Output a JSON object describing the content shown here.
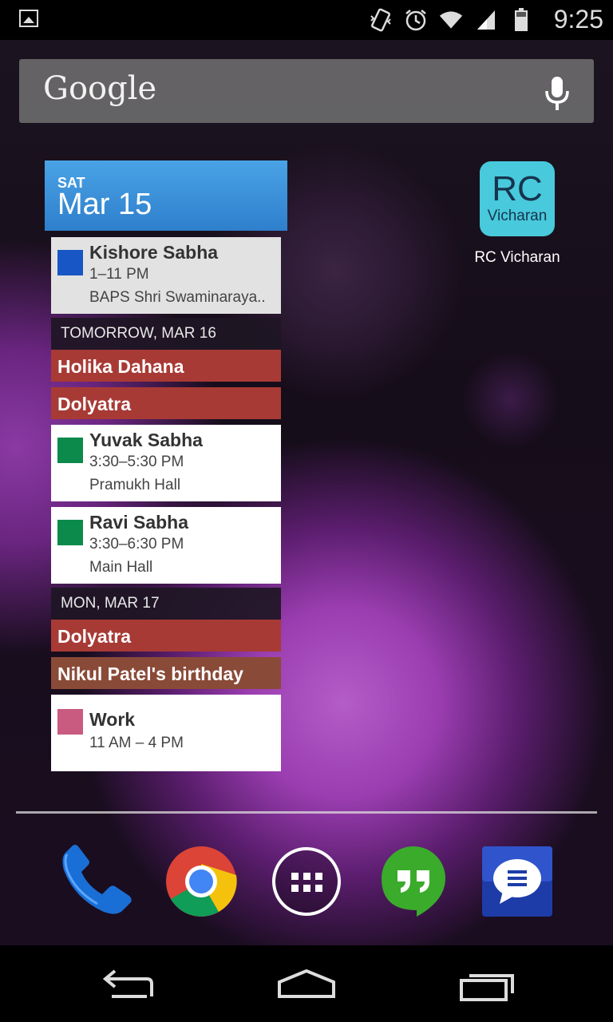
{
  "status_bar": {
    "time": "9:25",
    "icons": [
      "picture-icon",
      "vibrate-icon",
      "alarm-icon",
      "wifi-icon",
      "signal-icon",
      "battery-icon"
    ]
  },
  "search": {
    "logo_text": "Google",
    "icon": "mic-icon"
  },
  "calendar_widget": {
    "header": {
      "day": "SAT",
      "date": "Mar 15",
      "color": "#3b8fd9"
    },
    "events": [
      {
        "title": "Kishore Sabha",
        "time": "1–11 PM",
        "location": "BAPS Shri Swaminaraya..",
        "color": "#1756c4"
      }
    ],
    "tomorrow": {
      "label": "TOMORROW, MAR 16",
      "allday": [
        {
          "title": "Holika Dahana",
          "color": "#a83a35"
        },
        {
          "title": "Dolyatra",
          "color": "#a83a35"
        }
      ],
      "events": [
        {
          "title": "Yuvak Sabha",
          "time": "3:30–5:30 PM",
          "location": "Pramukh Hall",
          "color": "#0b8a4c"
        },
        {
          "title": "Ravi Sabha",
          "time": "3:30–6:30 PM",
          "location": "Main Hall",
          "color": "#0b8a4c"
        }
      ]
    },
    "monday": {
      "label": "MON, MAR 17",
      "allday": [
        {
          "title": "Dolyatra",
          "color": "#a83a35"
        },
        {
          "title": "Nikul Patel's birthday",
          "color": "#8a4a38"
        }
      ],
      "events": [
        {
          "title": "Work",
          "time": "11 AM – 4 PM",
          "color": "#c95a80"
        }
      ]
    }
  },
  "app_shortcut": {
    "icon_line1": "RC",
    "icon_line2": "Vicharan",
    "label": "RC Vicharan",
    "color": "#48c9dc"
  },
  "dock": [
    "phone-icon",
    "chrome-icon",
    "app-drawer-icon",
    "hangouts-icon",
    "messaging-icon"
  ],
  "nav_bar": [
    "back-icon",
    "home-icon",
    "recents-icon"
  ]
}
